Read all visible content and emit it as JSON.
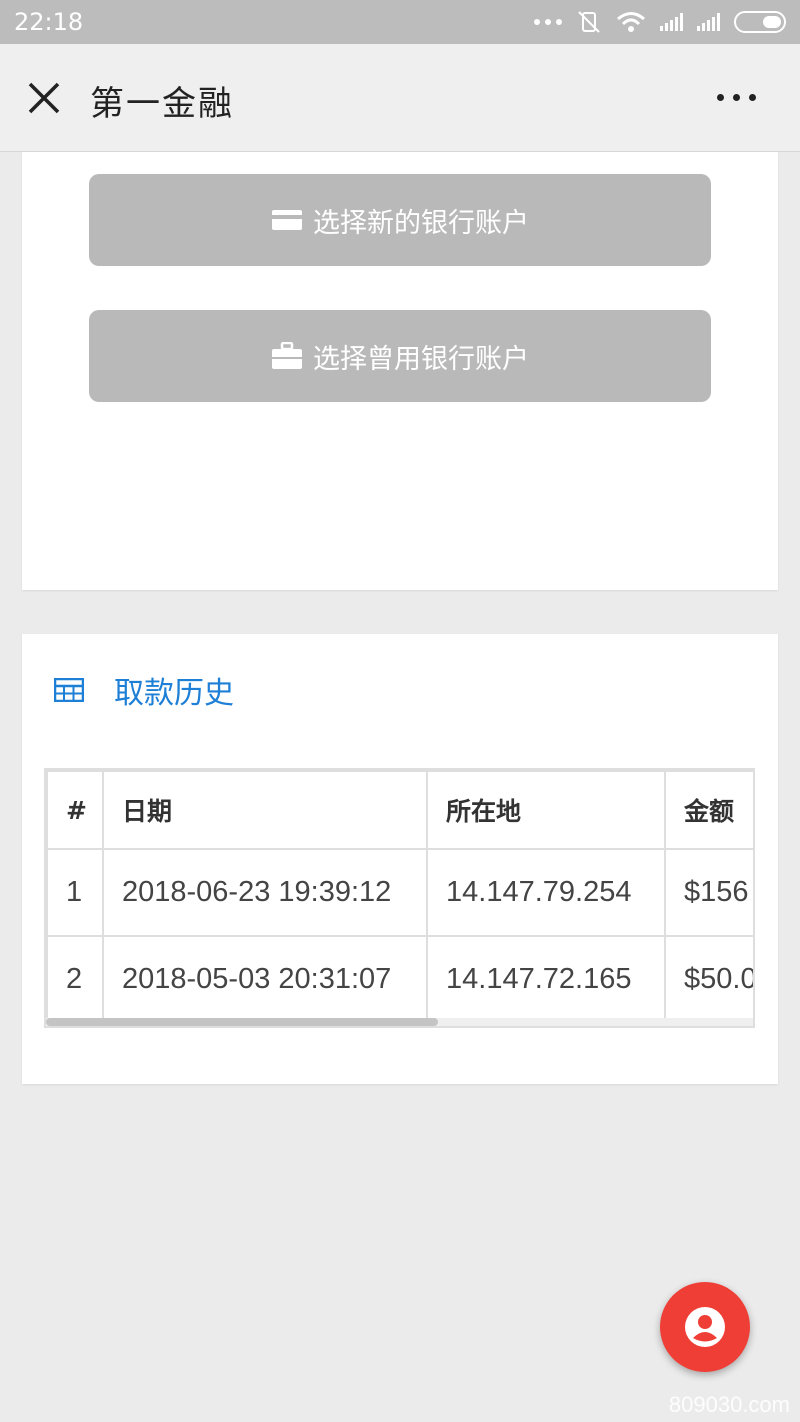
{
  "status_bar": {
    "time": "22:18"
  },
  "nav": {
    "title": "第一金融"
  },
  "actions": {
    "new_account_label": "选择新的银行账户",
    "used_account_label": "选择曾用银行账户"
  },
  "history": {
    "title": "取款历史",
    "columns": [
      "#",
      "日期",
      "所在地",
      "金额"
    ],
    "rows": [
      {
        "num": "1",
        "date": "2018-06-23 19:39:12",
        "location": "14.147.79.254",
        "amount": "$156"
      },
      {
        "num": "2",
        "date": "2018-05-03 20:31:07",
        "location": "14.147.72.165",
        "amount": "$50.0"
      }
    ]
  },
  "watermark": "809030.com",
  "colors": {
    "accent": "#1e7fd6",
    "fab": "#ef3e36",
    "button": "#b9b9b9"
  }
}
